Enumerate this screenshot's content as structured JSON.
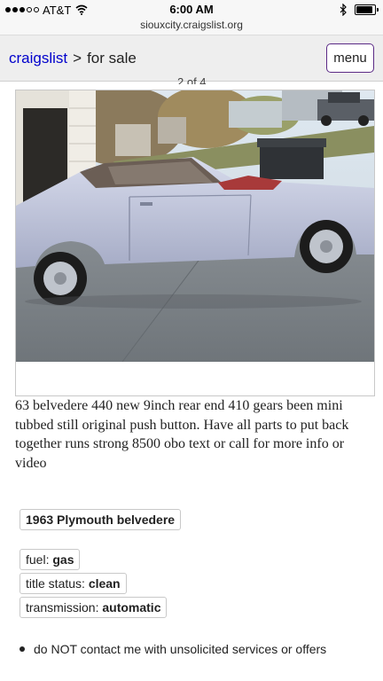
{
  "status_bar": {
    "carrier": "AT&T",
    "time": "6:00 AM",
    "signal_bars": 3,
    "battery_level": 0.9
  },
  "url": "siouxcity.craigslist.org",
  "header": {
    "site": "craigslist",
    "separator": ">",
    "category": "for sale",
    "menu_label": "menu"
  },
  "image_counter": "2 of 4",
  "posting": {
    "body": "63 belvedere 440 new 9inch rear end 410 gears been mini tubbed still original push button. Have all parts to put back together runs strong 8500 obo text or call for more info or video",
    "title_attr": "1963 Plymouth belvedere",
    "attributes": [
      {
        "label": "fuel: ",
        "value": "gas"
      },
      {
        "label": "title status: ",
        "value": "clean"
      },
      {
        "label": "transmission: ",
        "value": "automatic"
      }
    ],
    "notice": "do NOT contact me with unsolicited services or offers"
  },
  "colors": {
    "link": "#0000cc",
    "menu_border": "#5b2a86",
    "header_bg": "#eeeeee"
  },
  "icons": [
    "signal-dots-icon",
    "wifi-icon",
    "bluetooth-icon",
    "battery-icon"
  ]
}
